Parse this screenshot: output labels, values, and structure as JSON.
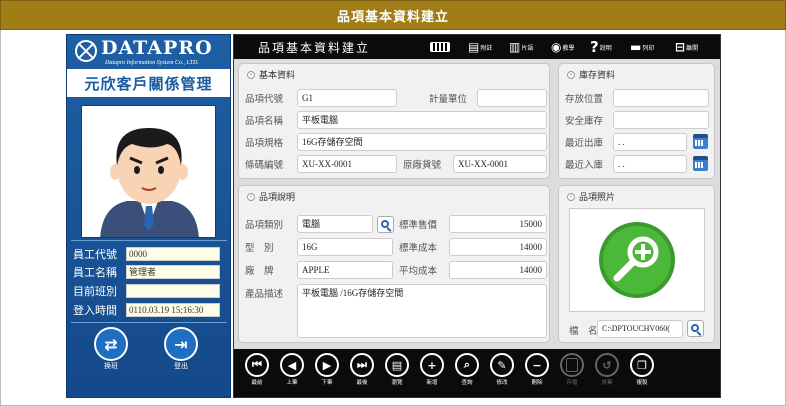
{
  "window_title": "品項基本資料建立",
  "sidebar": {
    "logo_text": "DATAPRO",
    "logo_sub": "Datapro Information System Co., LTD.",
    "company": "元欣客戶關係管理",
    "employee_id_label": "員工代號",
    "employee_id": "0000",
    "employee_name_label": "員工名稱",
    "employee_name": "管理者",
    "shift_label": "目前班別",
    "shift": "",
    "login_label": "登入時間",
    "login_time": "0110.03.19 15:16:30",
    "switch_label": "換班",
    "logout_label": "登出"
  },
  "header": {
    "title": "品項基本資料建立",
    "keyboard_icon": "keyboard-icon",
    "note_label": "附註",
    "tablet_label": "片語",
    "tutorial_label": "教學",
    "help_label": "說明",
    "print_label": "列印",
    "exit_label": "離開"
  },
  "basic": {
    "title": "基本資料",
    "code_label": "品項代號",
    "code": "G1",
    "unit_label": "計量單位",
    "unit": "",
    "name_label": "品項名稱",
    "name": "平板電腦",
    "spec_label": "品項規格",
    "spec": "16G存儲存空間",
    "barcode_label": "條碼編號",
    "barcode": "XU-XX-0001",
    "orig_label": "原廠貨號",
    "orig": "XU-XX-0001"
  },
  "stock": {
    "title": "庫存資料",
    "location_label": "存放位置",
    "location": "",
    "safety_label": "安全庫存",
    "safety": "",
    "last_out_label": "最近出庫",
    "last_out": ". .",
    "last_in_label": "最近入庫",
    "last_in": ". ."
  },
  "desc": {
    "title": "品項說明",
    "category_label": "品項類別",
    "category": "電腦",
    "std_price_label": "標準售價",
    "std_price": "15000",
    "model_label": "型　別",
    "model": "16G",
    "std_cost_label": "標準成本",
    "std_cost": "14000",
    "brand_label": "廠　牌",
    "brand": "APPLE",
    "avg_cost_label": "平均成本",
    "avg_cost": "14000",
    "desc_label": "產品描述",
    "desc_text": "平板電腦 /16G存儲存空間"
  },
  "photo": {
    "title": "品項照片",
    "file_label": "檔　名",
    "file_path": "C:\\DPTOUCHV060("
  },
  "footer": {
    "first": "最前",
    "prev": "上筆",
    "next": "下筆",
    "last": "最後",
    "browse": "瀏覽",
    "add": "新增",
    "query": "查詢",
    "edit": "修改",
    "delete": "刪除",
    "save": "存檔",
    "cancel": "放棄",
    "copy": "複製"
  },
  "colors": {
    "title_bar": "#a07d16",
    "sidebar": "#1f5fa5",
    "panel": "#f1f1f1",
    "toolbar": "#0b0b0b"
  }
}
